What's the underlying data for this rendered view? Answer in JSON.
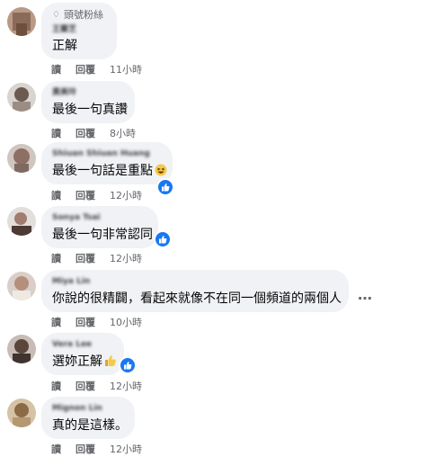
{
  "actions": {
    "read_label": "讀",
    "reply_label": "回覆"
  },
  "top_fan_badge": {
    "icon": "diamond-icon",
    "label": "頭號粉絲"
  },
  "comments": [
    {
      "author": "王蘭芝",
      "text": "正解",
      "time": "11小時"
    },
    {
      "author": "黃美玲",
      "text": "最後一句真讚",
      "time": "8小時"
    },
    {
      "author": "Shiuan Shiuan Huang",
      "text": "最後一句話是重點",
      "time": "12小時",
      "emoji": "laughing-emoji"
    },
    {
      "author": "Sonya Tsai",
      "text": "最後一句非常認同",
      "time": "12小時"
    },
    {
      "author": "Miya Lin",
      "text": "你說的很精闢，看起來就像不在同一個頻道的兩個人",
      "time": "10小時"
    },
    {
      "author": "Vera Lee",
      "text": "選妳正解",
      "time": "12小時",
      "emoji": "thumbs-up-emoji"
    },
    {
      "author": "Mignon Lin",
      "text": "真的是這樣。",
      "time": "12小時"
    }
  ],
  "more_options": "…",
  "colors": {
    "bubble": "#f0f2f5",
    "like": "#1877f2",
    "meta": "#65676b"
  }
}
